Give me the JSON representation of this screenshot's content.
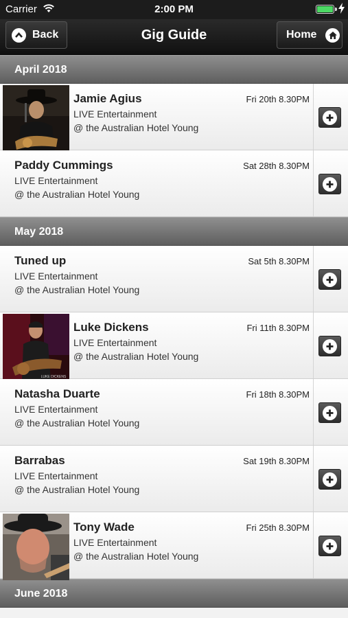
{
  "status": {
    "carrier": "Carrier",
    "time": "2:00 PM",
    "battery_level": 1.0
  },
  "nav": {
    "back_label": "Back",
    "title": "Gig Guide",
    "home_label": "Home"
  },
  "colors": {
    "accent_dark": "#1c1c1c",
    "section_bg": "#7a7a7a",
    "battery": "#4cd964"
  },
  "sections": [
    {
      "heading": "April 2018",
      "gigs": [
        {
          "name": "Jamie Agius",
          "date": "Fri 20th 8.30PM",
          "type": "LIVE Entertainment",
          "venue": "@ the Australian Hotel Young",
          "has_photo": true,
          "photo": "guitarist-in-black-hat"
        },
        {
          "name": "Paddy Cummings",
          "date": "Sat 28th 8.30PM",
          "type": "LIVE Entertainment",
          "venue": "@ the Australian Hotel Young",
          "has_photo": false
        }
      ]
    },
    {
      "heading": "May 2018",
      "gigs": [
        {
          "name": "Tuned up",
          "date": "Sat 5th 8.30PM",
          "type": "LIVE Entertainment",
          "venue": "@ the Australian Hotel Young",
          "has_photo": false
        },
        {
          "name": "Luke Dickens",
          "date": "Fri 11th 8.30PM",
          "type": "LIVE Entertainment",
          "venue": "@ the Australian Hotel Young",
          "has_photo": true,
          "photo": "guitarist-red-lighting",
          "photo_caption": "LUKE DICKENS"
        },
        {
          "name": "Natasha Duarte",
          "date": "Fri 18th 8.30PM",
          "type": "LIVE Entertainment",
          "venue": "@ the Australian Hotel Young",
          "has_photo": false
        },
        {
          "name": "Barrabas",
          "date": "Sat 19th 8.30PM",
          "type": "LIVE Entertainment",
          "venue": "@ the Australian Hotel Young",
          "has_photo": false
        },
        {
          "name": "Tony Wade",
          "date": "Fri 25th 8.30PM",
          "type": "LIVE Entertainment",
          "venue": "@ the Australian Hotel Young",
          "has_photo": true,
          "photo": "man-in-hat-with-guitar"
        }
      ]
    },
    {
      "heading": "June 2018",
      "gigs": []
    }
  ],
  "icons": {
    "back": "chevron-up-icon",
    "home": "home-icon",
    "add": "plus-icon",
    "wifi": "wifi-icon",
    "battery": "battery-icon",
    "charging": "bolt-icon"
  }
}
